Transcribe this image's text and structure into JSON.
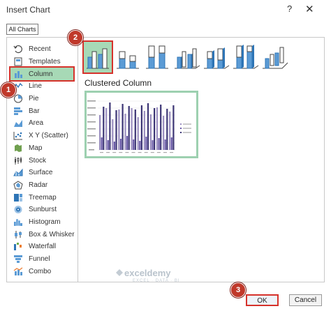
{
  "window": {
    "title": "Insert Chart",
    "help": "?",
    "close": "✕"
  },
  "tab": {
    "label": "All Charts"
  },
  "sidebar": {
    "items": [
      {
        "label": "Recent",
        "icon": "recent-icon"
      },
      {
        "label": "Templates",
        "icon": "templates-icon"
      },
      {
        "label": "Column",
        "icon": "column-chart-icon",
        "selected": true
      },
      {
        "label": "Line",
        "icon": "line-chart-icon"
      },
      {
        "label": "Pie",
        "icon": "pie-chart-icon"
      },
      {
        "label": "Bar",
        "icon": "bar-chart-icon"
      },
      {
        "label": "Area",
        "icon": "area-chart-icon"
      },
      {
        "label": "X Y (Scatter)",
        "icon": "scatter-chart-icon"
      },
      {
        "label": "Map",
        "icon": "map-chart-icon"
      },
      {
        "label": "Stock",
        "icon": "stock-chart-icon"
      },
      {
        "label": "Surface",
        "icon": "surface-chart-icon"
      },
      {
        "label": "Radar",
        "icon": "radar-chart-icon"
      },
      {
        "label": "Treemap",
        "icon": "treemap-chart-icon"
      },
      {
        "label": "Sunburst",
        "icon": "sunburst-chart-icon"
      },
      {
        "label": "Histogram",
        "icon": "histogram-chart-icon"
      },
      {
        "label": "Box & Whisker",
        "icon": "box-whisker-chart-icon"
      },
      {
        "label": "Waterfall",
        "icon": "waterfall-chart-icon"
      },
      {
        "label": "Funnel",
        "icon": "funnel-chart-icon"
      },
      {
        "label": "Combo",
        "icon": "combo-chart-icon"
      }
    ]
  },
  "subtypes": {
    "selected_name": "Clustered Column",
    "items": [
      {
        "name": "clustered-column",
        "selected": true
      },
      {
        "name": "stacked-column"
      },
      {
        "name": "100-stacked-column"
      },
      {
        "name": "3d-clustered-column"
      },
      {
        "name": "3d-stacked-column"
      },
      {
        "name": "3d-100-stacked-column"
      },
      {
        "name": "3d-column"
      }
    ]
  },
  "steps": {
    "one": "1",
    "two": "2",
    "three": "3"
  },
  "buttons": {
    "ok": "OK",
    "cancel": "Cancel"
  },
  "watermark": {
    "brand": "exceldemy",
    "tagline": "EXCEL · DATA · BI"
  },
  "colors": {
    "selected_bg": "#a7d9b6",
    "highlight_red": "#d6322b",
    "badge_red": "#c0392b",
    "accent_blue": "#5b9bd5"
  }
}
